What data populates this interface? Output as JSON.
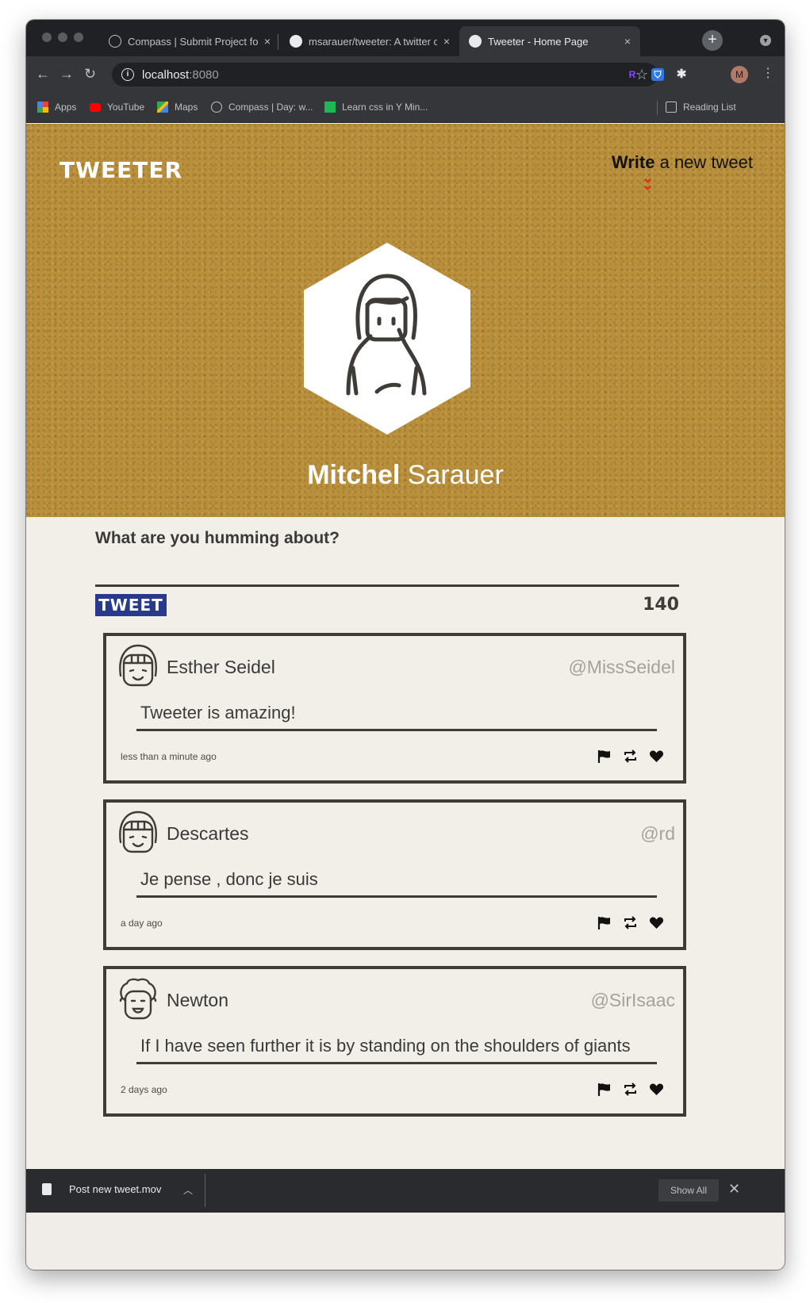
{
  "browser": {
    "tabs": [
      {
        "title": "Compass | Submit Project for E",
        "active": false
      },
      {
        "title": "msarauer/tweeter: A twitter clo",
        "active": false
      },
      {
        "title": "Tweeter - Home Page",
        "active": true
      }
    ],
    "tab_close_glyph": "×",
    "new_tab_glyph": "+",
    "address": {
      "host": "localhost",
      "port": ":8080"
    },
    "profile_initial": "M",
    "bookmarks": [
      {
        "label": "Apps",
        "icon": "apps-grid-icon"
      },
      {
        "label": "YouTube",
        "icon": "youtube-icon"
      },
      {
        "label": "Maps",
        "icon": "maps-icon"
      },
      {
        "label": "Compass | Day: w...",
        "icon": "compass-icon"
      },
      {
        "label": "Learn css in Y Min...",
        "icon": "learnxiny-icon"
      }
    ],
    "reading_list": "Reading List"
  },
  "page": {
    "brand": "TWEETER",
    "compose_link": {
      "bold": "Write",
      "rest": " a new tweet"
    },
    "user": {
      "first": "Mitchel",
      "last": " Sarauer"
    },
    "prompt": "What are you humming about?",
    "tweet_button": "TWEET",
    "counter": "140",
    "tweets": [
      {
        "name": "Esther Seidel",
        "handle": "@MissSeidel",
        "content": "Tweeter is amazing!",
        "time": "less than a minute ago"
      },
      {
        "name": "Descartes",
        "handle": "@rd",
        "content": "Je pense , donc je suis",
        "time": "a day ago"
      },
      {
        "name": "Newton",
        "handle": "@SirIsaac",
        "content": "If I have seen further it is by standing on the shoulders of giants",
        "time": "2 days ago"
      }
    ]
  },
  "download_bar": {
    "file": "Post new tweet.mov",
    "show_all": "Show All"
  },
  "colors": {
    "hero": "#b98f3b",
    "page_bg": "#f2efe9",
    "tweet_button": "#283a8a",
    "accent_chevron": "#e8261c",
    "border": "#3f3c38"
  }
}
